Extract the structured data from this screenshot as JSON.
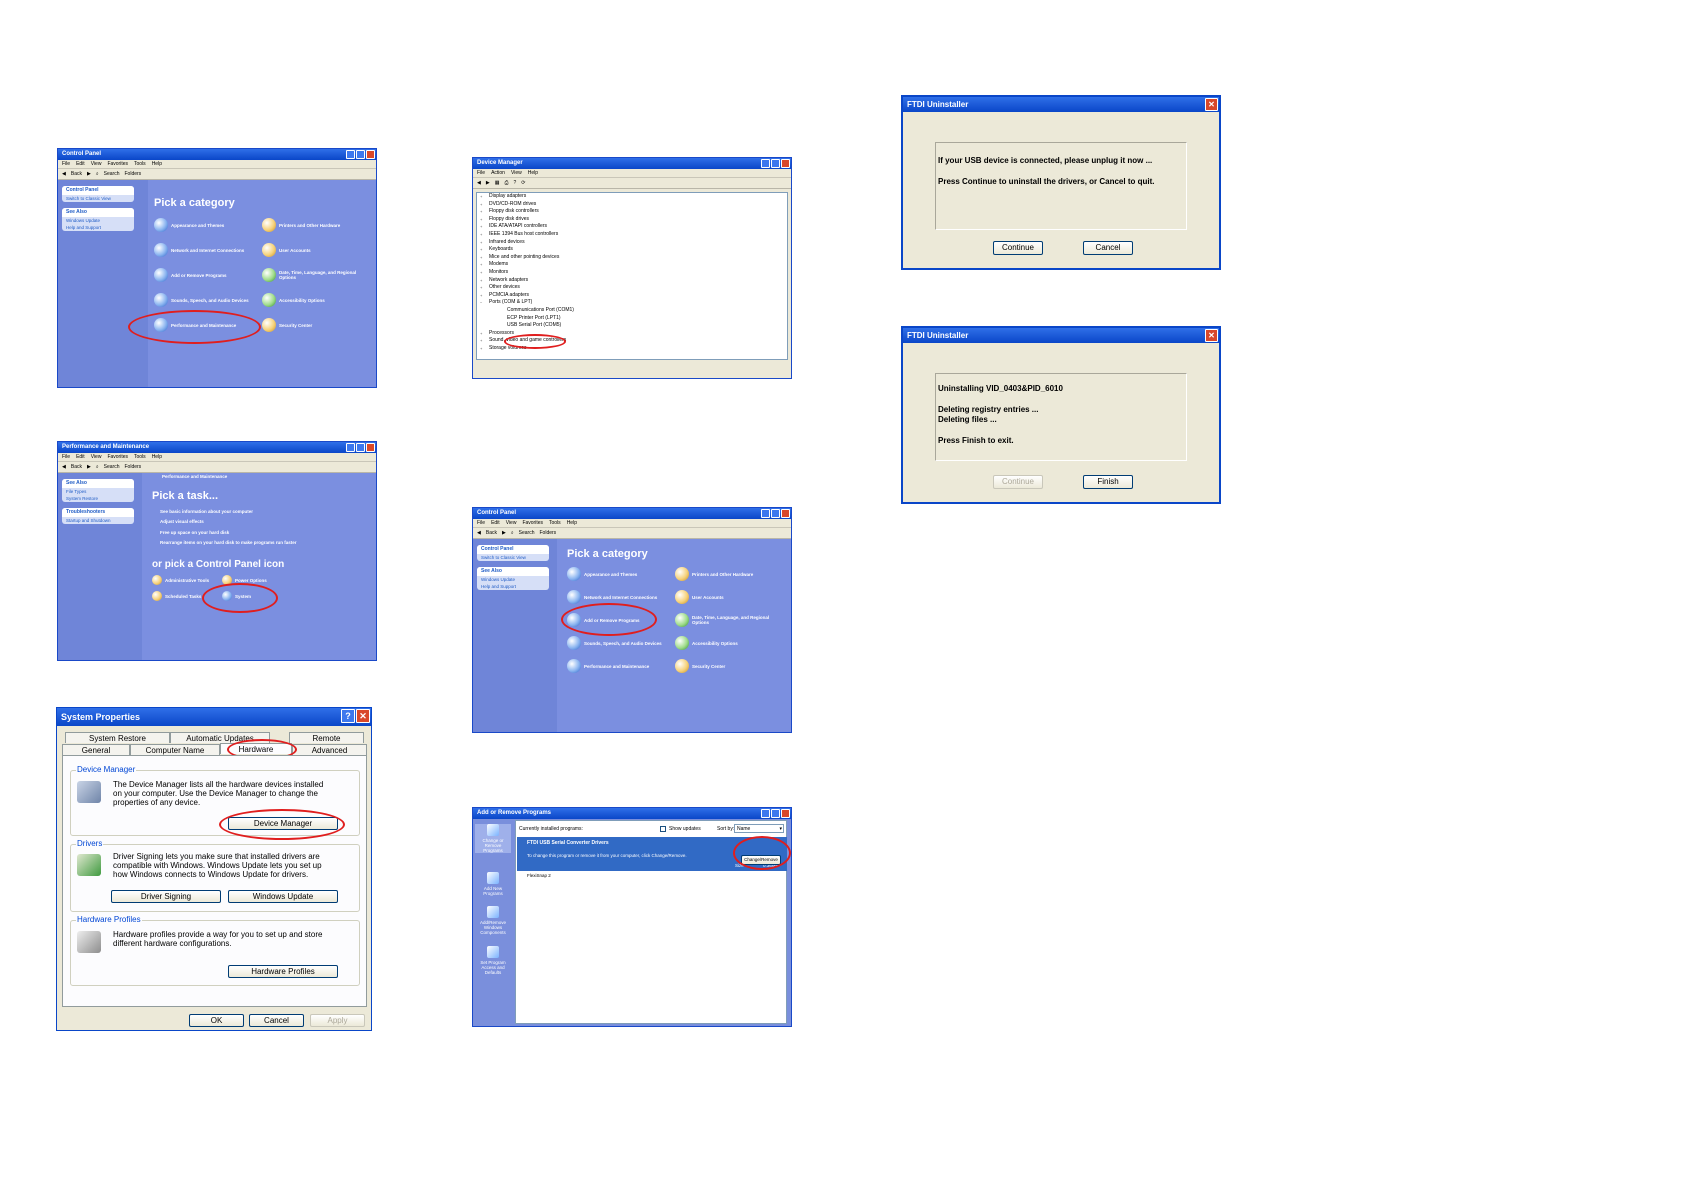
{
  "control_panel_1": {
    "title": "Control Panel",
    "menu": [
      "File",
      "Edit",
      "View",
      "Favorites",
      "Tools",
      "Help"
    ],
    "toolbar": [
      "Back",
      "Search",
      "Folders"
    ],
    "side_pane_title": "Control Panel",
    "side_switch": "Switch to Classic View",
    "see_also_title": "See Also",
    "see_also": [
      "Windows Update",
      "Help and Support"
    ],
    "heading": "Pick a category",
    "categories": [
      "Appearance and Themes",
      "Printers and Other Hardware",
      "Network and Internet Connections",
      "User Accounts",
      "Add or Remove Programs",
      "Date, Time, Language, and Regional Options",
      "Sounds, Speech, and Audio Devices",
      "Accessibility Options",
      "Performance and Maintenance",
      "Security Center"
    ]
  },
  "perf_maint": {
    "title": "Performance and Maintenance",
    "menu": [
      "File",
      "Edit",
      "View",
      "Favorites",
      "Tools",
      "Help"
    ],
    "toolbar": [
      "Back",
      "Search",
      "Folders"
    ],
    "see_also_title": "See Also",
    "see_also": [
      "File Types",
      "System Restore"
    ],
    "troubleshooters_title": "Troubleshooters",
    "troubleshooters": [
      "Startup and Shutdown"
    ],
    "banner": "Performance and Maintenance",
    "pick_task": "Pick a task...",
    "tasks": [
      "See basic information about your computer",
      "Adjust visual effects",
      "Free up space on your hard disk",
      "Rearrange items on your hard disk to make programs run faster"
    ],
    "pick_icon": "or pick a Control Panel icon",
    "icons": [
      "Administrative Tools",
      "Power Options",
      "Scheduled Tasks",
      "System"
    ]
  },
  "system_properties": {
    "title": "System Properties",
    "tabs_row1": [
      "System Restore",
      "Automatic Updates",
      "Remote"
    ],
    "tabs_row2": [
      "General",
      "Computer Name",
      "Hardware",
      "Advanced"
    ],
    "device_manager": {
      "heading": "Device Manager",
      "text": "The Device Manager lists all the hardware devices installed on your computer. Use the Device Manager to change the properties of any device.",
      "button": "Device Manager"
    },
    "drivers": {
      "heading": "Drivers",
      "text": "Driver Signing lets you make sure that installed drivers are compatible with Windows. Windows Update lets you set up how Windows connects to Windows Update for drivers.",
      "button1": "Driver Signing",
      "button2": "Windows Update"
    },
    "hardware_profiles": {
      "heading": "Hardware Profiles",
      "text": "Hardware profiles provide a way for you to set up and store different hardware configurations.",
      "button": "Hardware Profiles"
    },
    "ok": "OK",
    "cancel": "Cancel",
    "apply": "Apply"
  },
  "device_manager": {
    "title": "Device Manager",
    "menu": [
      "File",
      "Action",
      "View",
      "Help"
    ],
    "tree": [
      {
        "label": "Display adapters",
        "child": false
      },
      {
        "label": "DVD/CD-ROM drives",
        "child": false
      },
      {
        "label": "Floppy disk controllers",
        "child": false
      },
      {
        "label": "Floppy disk drives",
        "child": false
      },
      {
        "label": "IDE ATA/ATAPI controllers",
        "child": false
      },
      {
        "label": "IEEE 1394 Bus host controllers",
        "child": false
      },
      {
        "label": "Infrared devices",
        "child": false
      },
      {
        "label": "Keyboards",
        "child": false
      },
      {
        "label": "Mice and other pointing devices",
        "child": false
      },
      {
        "label": "Modems",
        "child": false
      },
      {
        "label": "Monitors",
        "child": false
      },
      {
        "label": "Network adapters",
        "child": false
      },
      {
        "label": "Other devices",
        "child": false
      },
      {
        "label": "PCMCIA adapters",
        "child": false
      },
      {
        "label": "Ports (COM & LPT)",
        "child": false,
        "open": true
      },
      {
        "label": "Communications Port (COM1)",
        "child": true
      },
      {
        "label": "ECP Printer Port (LPT1)",
        "child": true
      },
      {
        "label": "USB Serial Port (COM5)",
        "child": true
      },
      {
        "label": "Processors",
        "child": false
      },
      {
        "label": "Sound, video and game controllers",
        "child": false
      },
      {
        "label": "Storage volumes",
        "child": false
      }
    ]
  },
  "control_panel_2": {
    "title": "Control Panel",
    "menu": [
      "File",
      "Edit",
      "View",
      "Favorites",
      "Tools",
      "Help"
    ],
    "toolbar": [
      "Back",
      "Search",
      "Folders"
    ],
    "side_pane_title": "Control Panel",
    "side_switch": "Switch to Classic View",
    "see_also_title": "See Also",
    "see_also": [
      "Windows Update",
      "Help and Support"
    ],
    "heading": "Pick a category",
    "categories": [
      "Appearance and Themes",
      "Printers and Other Hardware",
      "Network and Internet Connections",
      "User Accounts",
      "Add or Remove Programs",
      "Date, Time, Language, and Regional Options",
      "Sounds, Speech, and Audio Devices",
      "Accessibility Options",
      "Performance and Maintenance",
      "Security Center"
    ]
  },
  "add_remove": {
    "title": "Add or Remove Programs",
    "side": [
      "Change or Remove Programs",
      "Add New Programs",
      "Add/Remove Windows Components",
      "Set Program Access and Defaults"
    ],
    "installed_label": "Currently installed programs:",
    "show_updates": "Show updates",
    "sort_by": "Sort by:",
    "sort_value": "Name",
    "program": "FTDI USB Serial Converter Drivers",
    "program_hint": "To change this program or remove it from your computer, click Change/Remove.",
    "change_remove": "Change/Remove",
    "size_label": "Size",
    "size_value": "0.36MB",
    "program2": "FlexiSnap 2"
  },
  "ftdi_1": {
    "title": "FTDI Uninstaller",
    "line1": "If your USB device is connected, please unplug it now ...",
    "line2": "Press Continue to uninstall the drivers, or Cancel to quit.",
    "continue": "Continue",
    "cancel": "Cancel"
  },
  "ftdi_2": {
    "title": "FTDI Uninstaller",
    "line1": "Uninstalling VID_0403&PID_6010",
    "line2": "Deleting registry entries ...",
    "line3": "Deleting files ...",
    "line4": "Press Finish to exit.",
    "continue": "Continue",
    "finish": "Finish"
  }
}
